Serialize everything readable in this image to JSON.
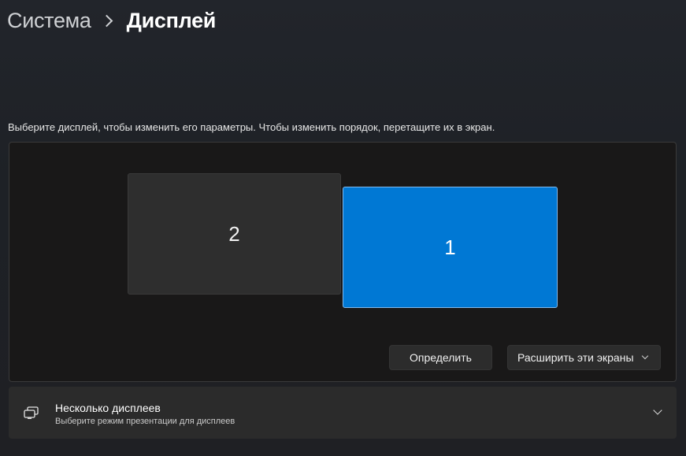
{
  "breadcrumb": {
    "parent": "Система",
    "current": "Дисплей"
  },
  "instruction": "Выберите дисплей, чтобы изменить его параметры. Чтобы изменить порядок, перетащите их в экран.",
  "monitors": {
    "secondary_label": "2",
    "primary_label": "1",
    "selected": "1"
  },
  "buttons": {
    "identify": "Определить",
    "extend": "Расширить эти экраны"
  },
  "multiple_displays": {
    "title": "Несколько дисплеев",
    "subtitle": "Выберите режим презентации для дисплеев",
    "icon": "multiple-displays-icon"
  },
  "colors": {
    "accent": "#0078d4",
    "panel": "#191818",
    "card": "#2b2b2b"
  }
}
